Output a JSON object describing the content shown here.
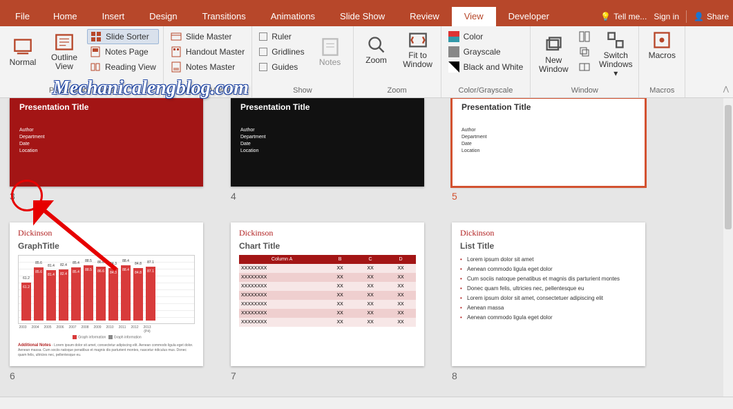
{
  "tabs": {
    "file": "File",
    "home": "Home",
    "insert": "Insert",
    "design": "Design",
    "transitions": "Transitions",
    "animations": "Animations",
    "slideshow": "Slide Show",
    "review": "Review",
    "view": "View",
    "developer": "Developer",
    "tellme": "Tell me...",
    "signin": "Sign in",
    "share": "Share"
  },
  "ribbon": {
    "presentation_views": {
      "normal": "Normal",
      "outline": "Outline View",
      "slide_sorter": "Slide Sorter",
      "notes_page": "Notes Page",
      "reading_view": "Reading View",
      "title": "Presentation Views"
    },
    "master_views": {
      "slide_master": "Slide Master",
      "handout_master": "Handout Master",
      "notes_master": "Notes Master",
      "title": "Master Views"
    },
    "show": {
      "ruler": "Ruler",
      "gridlines": "Gridlines",
      "guides": "Guides",
      "notes": "Notes",
      "title": "Show"
    },
    "zoom": {
      "zoom": "Zoom",
      "fit": "Fit to Window",
      "title": "Zoom"
    },
    "colorgrayscale": {
      "color": "Color",
      "grayscale": "Grayscale",
      "bw": "Black and White",
      "title": "Color/Grayscale"
    },
    "window": {
      "new_window": "New Window",
      "arrange": "Arrange All",
      "cascade": "Cascade",
      "split": "Move Split",
      "switch": "Switch Windows",
      "title": "Window"
    },
    "macros": {
      "macros": "Macros",
      "title": "Macros"
    }
  },
  "watermark": "Mechanicalengblog.com",
  "slides": {
    "s3": {
      "num": "3",
      "title": "Presentation Title",
      "author": "Author",
      "dept": "Department",
      "date": "Date",
      "loc": "Location"
    },
    "s4": {
      "num": "4",
      "title": "Presentation Title",
      "author": "Author",
      "dept": "Department",
      "date": "Date",
      "loc": "Location"
    },
    "s5": {
      "num": "5",
      "title": "Presentation Title",
      "author": "Author",
      "dept": "Department",
      "date": "Date",
      "loc": "Location"
    },
    "s6": {
      "num": "6",
      "brand": "Dickinson",
      "title": "GraphTitle",
      "notes_label": "Additional Notes",
      "notes_text": " - Lorem ipsum dolor sit amet, consectetur adipiscing elit. Aenean commodo ligula eget dolor. Aenean massa. Cum sociis natoque penatibus et magnis dis parturient montes, nascetur ridiculus mus. Donec quam felis, ultricies nec, pellentesque eu.",
      "legend_a": "Graph information",
      "legend_b": "Graph information"
    },
    "s7": {
      "num": "7",
      "brand": "Dickinson",
      "title": "Chart Title",
      "cols": [
        "Column A",
        "B",
        "C",
        "D"
      ]
    },
    "s8": {
      "num": "8",
      "brand": "Dickinson",
      "title": "List Title",
      "b1": "Lorem ipsum dolor sit amet",
      "b2": "Aenean commodo ligula eget dolor",
      "b3": "Cum sociis natoque penatibus et magnis dis parturient montes",
      "b4": "Donec quam felis, ultricies nec, pellentesque eu",
      "b5": "Lorem ipsum dolor sit amet, consectetuer adipiscing elit",
      "b6": "Aenean massa",
      "b7": "Aenean commodo ligula eget dolor"
    }
  },
  "chart_data": [
    {
      "type": "bar",
      "slide": 6,
      "title": "GraphTitle",
      "categories": [
        "2003",
        "2004",
        "2005",
        "2006",
        "2007",
        "2008",
        "2009",
        "2010",
        "2011",
        "2012",
        "2013 (P4)"
      ],
      "series": [
        {
          "name": "Graph information",
          "values": [
            61.2,
            85.6,
            81.4,
            82.4,
            85.4,
            88.5,
            86.6,
            84.3,
            88.4,
            84.8,
            87.1
          ]
        }
      ],
      "data_labels": [
        "61.2",
        "85.6",
        "81.4",
        "82.4",
        "85.4",
        "88.5",
        "86.6",
        "84.3",
        "88.4",
        "84.8",
        "87.1"
      ],
      "ylim": [
        0,
        100
      ]
    },
    {
      "type": "table",
      "slide": 7,
      "title": "Chart Title",
      "columns": [
        "Column A",
        "B",
        "C",
        "D"
      ],
      "rows": [
        [
          "XXXXXXXX",
          "XX",
          "XX",
          "XX"
        ],
        [
          "XXXXXXXX",
          "XX",
          "XX",
          "XX"
        ],
        [
          "XXXXXXXX",
          "XX",
          "XX",
          "XX"
        ],
        [
          "XXXXXXXX",
          "XX",
          "XX",
          "XX"
        ],
        [
          "XXXXXXXX",
          "XX",
          "XX",
          "XX"
        ],
        [
          "XXXXXXXX",
          "XX",
          "XX",
          "XX"
        ],
        [
          "XXXXXXXX",
          "XX",
          "XX",
          "XX"
        ]
      ]
    }
  ]
}
